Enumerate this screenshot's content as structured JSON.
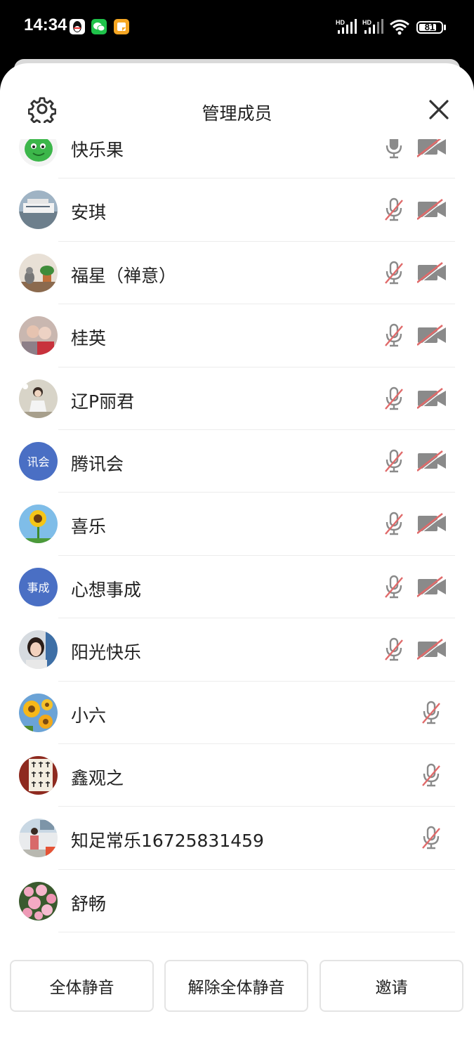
{
  "status_bar": {
    "time": "14:34",
    "battery": "81",
    "battery_level": 0.81,
    "signal_labels": [
      "HD",
      "HD"
    ],
    "notification_icons": [
      "qq-icon",
      "wechat-icon",
      "notes-app-icon"
    ]
  },
  "header": {
    "title": "管理成员",
    "settings_icon": "gear-icon",
    "close_icon": "close-icon"
  },
  "colors": {
    "muted_red": "#e06a6a",
    "icon_gray": "#8a8a8a",
    "avatar_blue": "#4a6fc4"
  },
  "members": [
    {
      "name": "快乐果",
      "mic": "on",
      "camera": "off",
      "avatar": "green-cartoon"
    },
    {
      "name": "安琪",
      "mic": "muted",
      "camera": "off",
      "avatar": "ship-photo"
    },
    {
      "name": "福星（禅意）",
      "mic": "muted",
      "camera": "off",
      "avatar": "cat-plant-photo"
    },
    {
      "name": "桂英",
      "mic": "muted",
      "camera": "off",
      "avatar": "portrait-photo"
    },
    {
      "name": "辽P丽君",
      "mic": "muted",
      "camera": "off",
      "avatar": "person-photo"
    },
    {
      "name": "腾讯会",
      "mic": "muted",
      "camera": "off",
      "avatar": "text",
      "avatar_text": "讯会"
    },
    {
      "name": "喜乐",
      "mic": "muted",
      "camera": "off",
      "avatar": "sunflower-photo"
    },
    {
      "name": "心想事成",
      "mic": "muted",
      "camera": "off",
      "avatar": "text",
      "avatar_text": "事成"
    },
    {
      "name": "阳光快乐",
      "mic": "muted",
      "camera": "off",
      "avatar": "selfie-photo"
    },
    {
      "name": "小六",
      "mic": "muted",
      "camera": "none",
      "avatar": "sunflowers-photo"
    },
    {
      "name": "鑫观之",
      "mic": "muted",
      "camera": "none",
      "avatar": "calligraphy-photo"
    },
    {
      "name": "知足常乐16725831459",
      "mic": "muted",
      "camera": "none",
      "avatar": "outdoor-photo"
    },
    {
      "name": "舒畅",
      "mic": "none",
      "camera": "none",
      "avatar": "pink-flowers-photo"
    }
  ],
  "footer": {
    "mute_all": "全体静音",
    "unmute_all": "解除全体静音",
    "invite": "邀请"
  }
}
